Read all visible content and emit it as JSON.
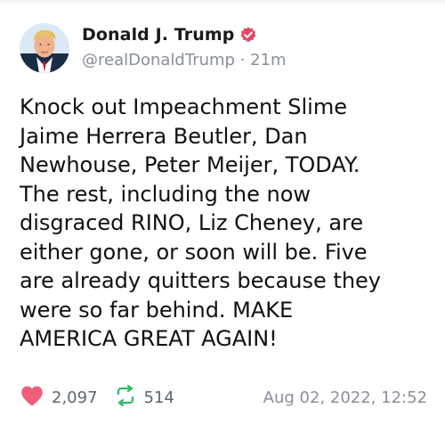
{
  "author": {
    "display_name": "Donald J. Trump",
    "handle": "@realDonaldTrump",
    "age": "21m",
    "separator": " · ",
    "avatar_icon": "profile-photo",
    "verified_icon": "verified-badge-icon"
  },
  "post": {
    "text": "Knock out Impeachment Slime\nJaime Herrera Beutler, Dan\nNewhouse, Peter Meijer, TODAY.\nThe rest, including the now\ndisgraced RINO, Liz Cheney, are\neither gone, or soon will be. Five\nare already quitters because they\nwere so far behind. MAKE\nAMERICA GREAT AGAIN!"
  },
  "stats": {
    "likes": "2,097",
    "reposts": "514",
    "like_icon": "heart-icon",
    "repost_icon": "repost-icon"
  },
  "timestamp": "Aug 02, 2022, 12:52",
  "colors": {
    "heart": "#ee5d7a",
    "repost": "#2dbb63",
    "verified": "#e24a65",
    "muted": "#8a8f98"
  }
}
